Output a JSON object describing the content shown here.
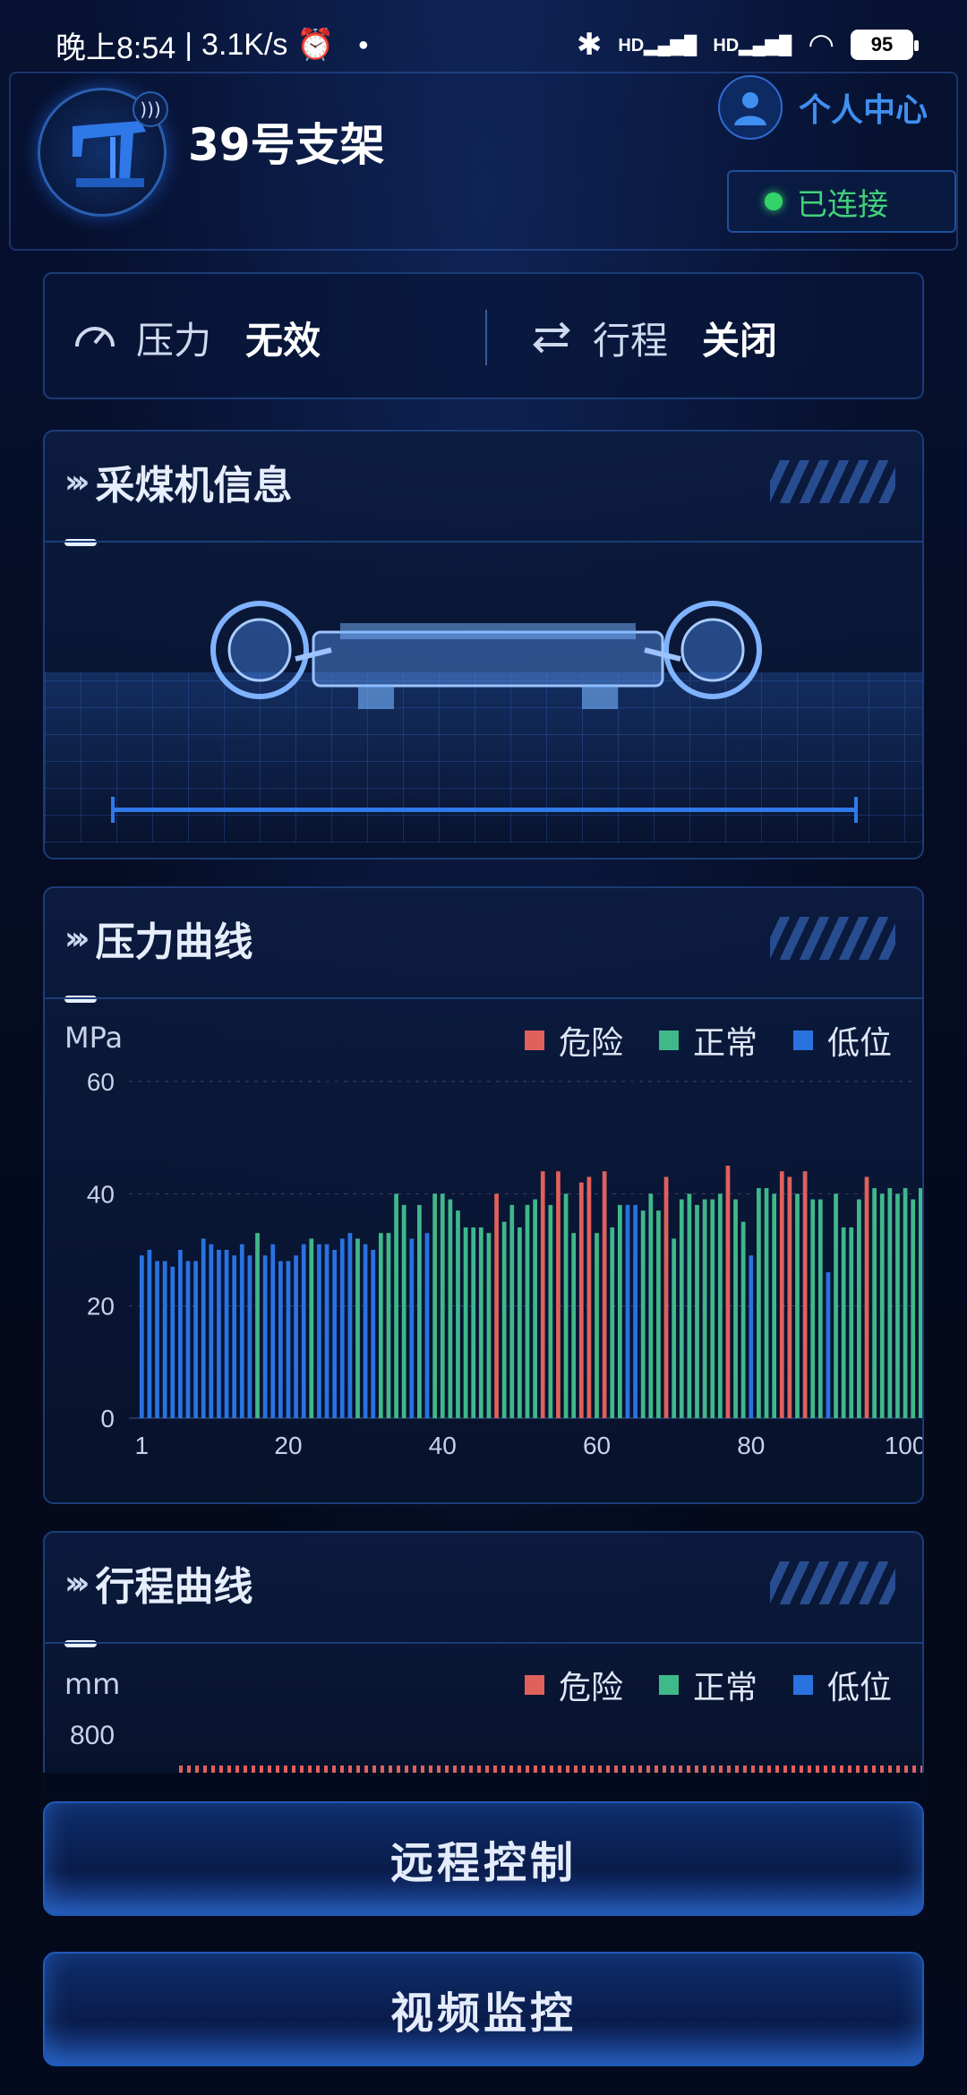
{
  "status_bar": {
    "time": "晚上8:54",
    "net_speed": "3.1K/s",
    "signal_tag_1": "HD",
    "signal_tag_2": "HD",
    "battery": "95"
  },
  "header": {
    "title": "39号支架",
    "personal_center": "个人中心",
    "connection_status": "已连接"
  },
  "status_strip": {
    "pressure_label": "压力",
    "pressure_value": "无效",
    "stroke_label": "行程",
    "stroke_value": "关闭"
  },
  "shearer_panel": {
    "title": "采煤机信息"
  },
  "pressure_panel": {
    "title": "压力曲线",
    "unit": "MPa",
    "legend": [
      {
        "label": "危险",
        "color": "#e0605c"
      },
      {
        "label": "正常",
        "color": "#3fb88a"
      },
      {
        "label": "低位",
        "color": "#2a72e0"
      }
    ]
  },
  "stroke_panel": {
    "title": "行程曲线",
    "unit": "mm",
    "legend": [
      {
        "label": "危险",
        "color": "#e0605c"
      },
      {
        "label": "正常",
        "color": "#3fb88a"
      },
      {
        "label": "低位",
        "color": "#2a72e0"
      }
    ],
    "y_tick_top": "800"
  },
  "buttons": {
    "remote_control": "远程控制",
    "video_monitor": "视频监控"
  },
  "chart_data": {
    "type": "bar",
    "ylabel": "MPa",
    "ylim": [
      0,
      60
    ],
    "yticks": [
      0,
      20,
      40,
      60
    ],
    "xticks": [
      1,
      20,
      40,
      60,
      80,
      100
    ],
    "xlim": [
      1,
      102
    ],
    "grid": "horizontal",
    "legend_position": "top-right",
    "series_colors": {
      "danger": "#e0605c",
      "normal": "#3fb88a",
      "low": "#2a72e0"
    },
    "values": [
      29,
      30,
      28,
      28,
      27,
      30,
      28,
      28,
      32,
      31,
      30,
      30,
      29,
      31,
      29,
      33,
      29,
      31,
      28,
      28,
      29,
      31,
      32,
      31,
      31,
      30,
      32,
      33,
      32,
      31,
      30,
      33,
      33,
      40,
      38,
      32,
      38,
      33,
      40,
      40,
      39,
      37,
      34,
      34,
      34,
      33,
      40,
      35,
      38,
      34,
      38,
      39,
      44,
      38,
      44,
      40,
      33,
      42,
      43,
      33,
      44,
      34,
      38,
      38,
      38,
      37,
      40,
      37,
      43,
      32,
      39,
      40,
      38,
      39,
      39,
      40,
      45,
      39,
      35,
      29,
      41,
      41,
      40,
      44,
      43,
      40,
      44,
      39,
      39,
      26,
      40,
      34,
      34,
      39,
      43,
      41,
      40,
      41,
      40,
      41,
      39,
      41
    ],
    "categories_status": [
      "low",
      "low",
      "low",
      "low",
      "low",
      "low",
      "low",
      "low",
      "low",
      "low",
      "low",
      "low",
      "low",
      "low",
      "low",
      "normal",
      "low",
      "low",
      "low",
      "low",
      "low",
      "low",
      "normal",
      "low",
      "low",
      "low",
      "low",
      "low",
      "normal",
      "low",
      "low",
      "normal",
      "normal",
      "normal",
      "normal",
      "low",
      "normal",
      "low",
      "normal",
      "normal",
      "normal",
      "normal",
      "normal",
      "normal",
      "normal",
      "normal",
      "danger",
      "normal",
      "normal",
      "normal",
      "normal",
      "normal",
      "danger",
      "normal",
      "danger",
      "normal",
      "normal",
      "danger",
      "danger",
      "normal",
      "danger",
      "normal",
      "normal",
      "low",
      "low",
      "normal",
      "normal",
      "normal",
      "danger",
      "normal",
      "normal",
      "normal",
      "normal",
      "normal",
      "normal",
      "normal",
      "danger",
      "normal",
      "normal",
      "low",
      "normal",
      "normal",
      "normal",
      "danger",
      "danger",
      "normal",
      "danger",
      "normal",
      "normal",
      "low",
      "normal",
      "normal",
      "normal",
      "normal",
      "danger",
      "normal",
      "normal",
      "normal",
      "normal",
      "normal",
      "normal",
      "normal"
    ]
  }
}
